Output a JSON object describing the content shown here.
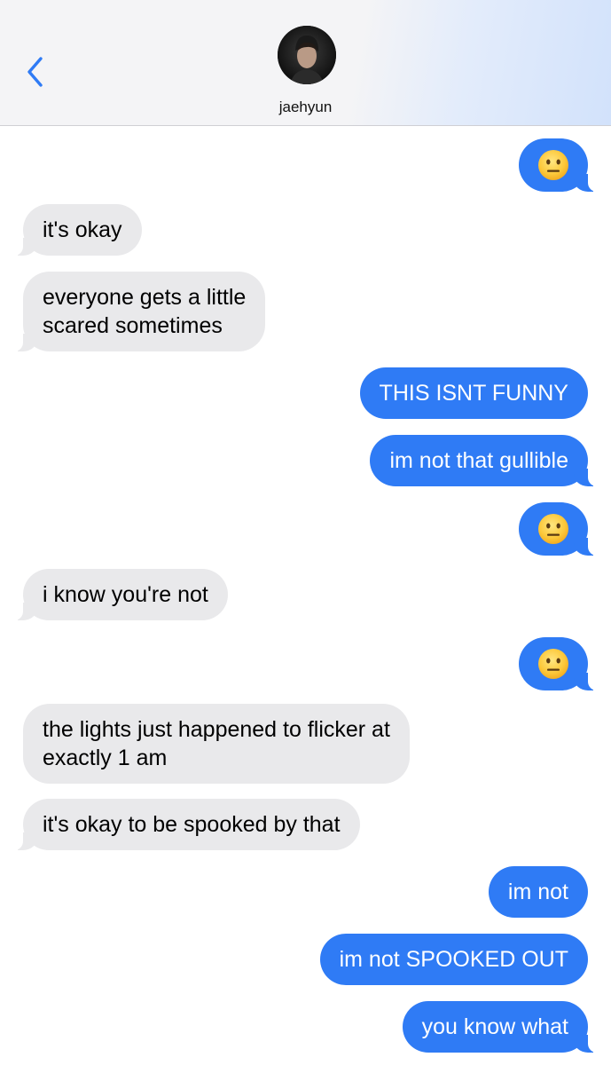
{
  "header": {
    "contact_name": "jaehyun"
  },
  "messages": [
    {
      "id": "m1",
      "direction": "out",
      "type": "emoji",
      "icon": "neutral-face-emoji"
    },
    {
      "id": "m2",
      "direction": "in",
      "text": "it's okay"
    },
    {
      "id": "m3",
      "direction": "in",
      "lines": [
        "everyone gets a little",
        "scared sometimes"
      ]
    },
    {
      "id": "m4",
      "direction": "out",
      "text": "THIS ISNT FUNNY"
    },
    {
      "id": "m5",
      "direction": "out",
      "text": "im not that gullible"
    },
    {
      "id": "m6",
      "direction": "out",
      "type": "emoji",
      "icon": "neutral-face-emoji"
    },
    {
      "id": "m7",
      "direction": "in",
      "text": "i know you're not"
    },
    {
      "id": "m8",
      "direction": "out",
      "type": "emoji",
      "icon": "neutral-face-emoji"
    },
    {
      "id": "m9",
      "direction": "in",
      "lines": [
        "the lights just happened to flicker at",
        "exactly 1 am"
      ]
    },
    {
      "id": "m10",
      "direction": "in",
      "text": "it's okay to be spooked by that"
    },
    {
      "id": "m11",
      "direction": "out",
      "text": "im not"
    },
    {
      "id": "m12",
      "direction": "out",
      "text": "im not SPOOKED OUT"
    },
    {
      "id": "m13",
      "direction": "out",
      "text": "you know what"
    }
  ],
  "colors": {
    "outgoing_bubble": "#2f7bf5",
    "incoming_bubble": "#e9e9eb",
    "accent": "#2f7bf5"
  }
}
